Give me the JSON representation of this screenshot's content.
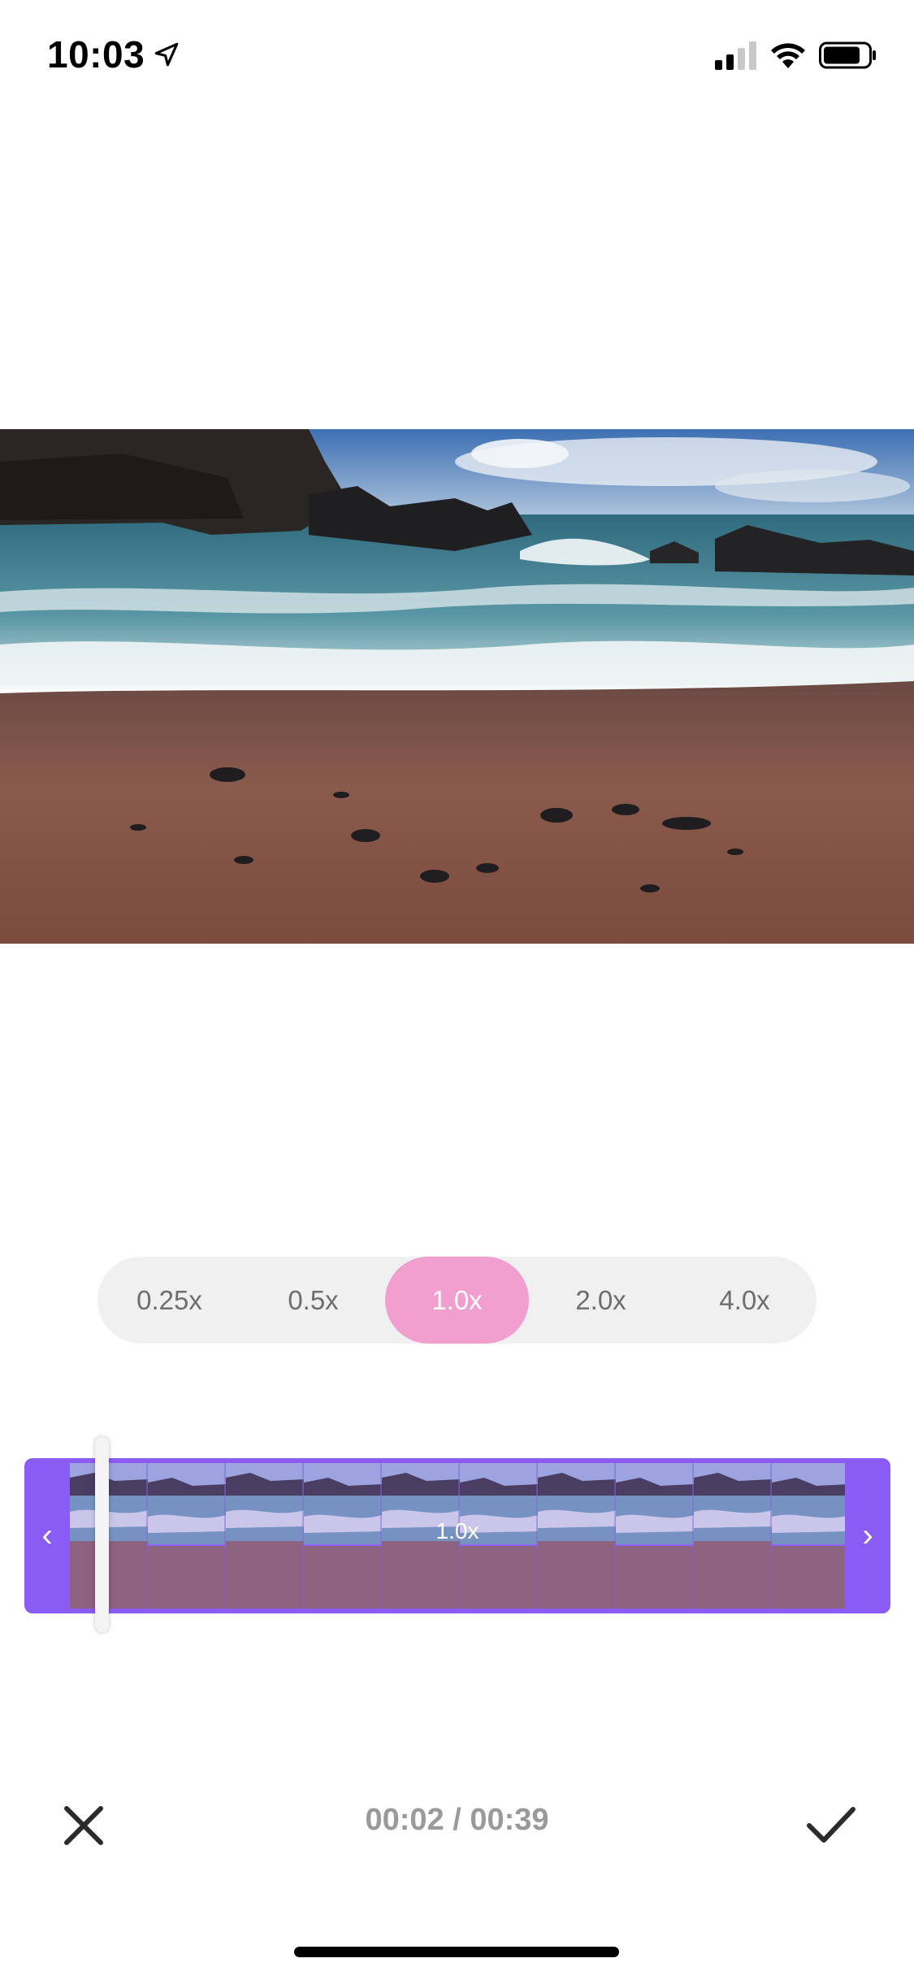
{
  "status_bar": {
    "time": "10:03",
    "icons": [
      "location-arrow-icon",
      "signal-icon",
      "wifi-icon",
      "battery-icon"
    ]
  },
  "video": {
    "description_icon": "video-preview"
  },
  "speed": {
    "options": [
      "0.25x",
      "0.5x",
      "1.0x",
      "2.0x",
      "4.0x"
    ],
    "selected": "1.0x",
    "accent_color": "#f09fcf"
  },
  "timeline": {
    "speed_label": "1.0x",
    "accent_color": "#8a5cf5",
    "left_arrow": "‹",
    "right_arrow": "›"
  },
  "controls": {
    "time_readout": "00:02 / 00:39",
    "close_icon": "close-icon",
    "confirm_icon": "checkmark-icon"
  }
}
